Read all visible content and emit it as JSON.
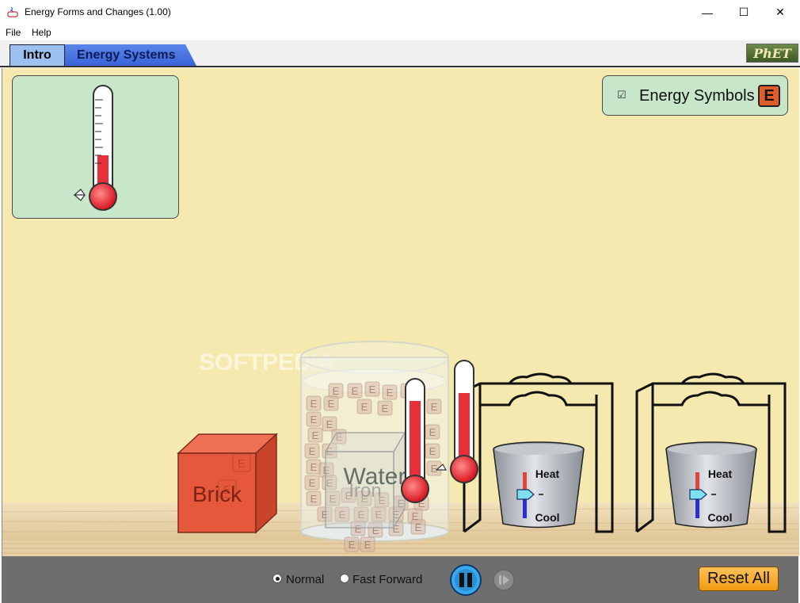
{
  "window": {
    "title": "Energy Forms and Changes (1.00)",
    "minimize": "—",
    "maximize": "☐",
    "close": "✕"
  },
  "menu": [
    "File",
    "Help"
  ],
  "tabs": [
    {
      "label": "Intro",
      "selected": true
    },
    {
      "label": "Energy Systems",
      "selected": false
    }
  ],
  "logo": "PhET",
  "energy_symbols": {
    "label": "Energy Symbols",
    "checked": true,
    "badge": "E"
  },
  "objects": {
    "brick_label": "Brick",
    "water_label": "Water",
    "iron_label": "Iron",
    "burner_heat_label": "Heat",
    "burner_cool_label": "Cool"
  },
  "watermark": "SOFTPEDIA",
  "controls": {
    "speed_options": [
      {
        "label": "Normal",
        "selected": true
      },
      {
        "label": "Fast Forward",
        "selected": false
      }
    ],
    "reset_label": "Reset All"
  },
  "colors": {
    "background": "#f5e9b0",
    "panel": "#c8e6c9",
    "brick": "#e5583b",
    "thermometer_fluid": "#e8303a",
    "shelf": "#e9d3a9",
    "tab_selected": "#9cc0f0",
    "tab_other": "#4a74e0",
    "reset_button": "#f5a623"
  }
}
